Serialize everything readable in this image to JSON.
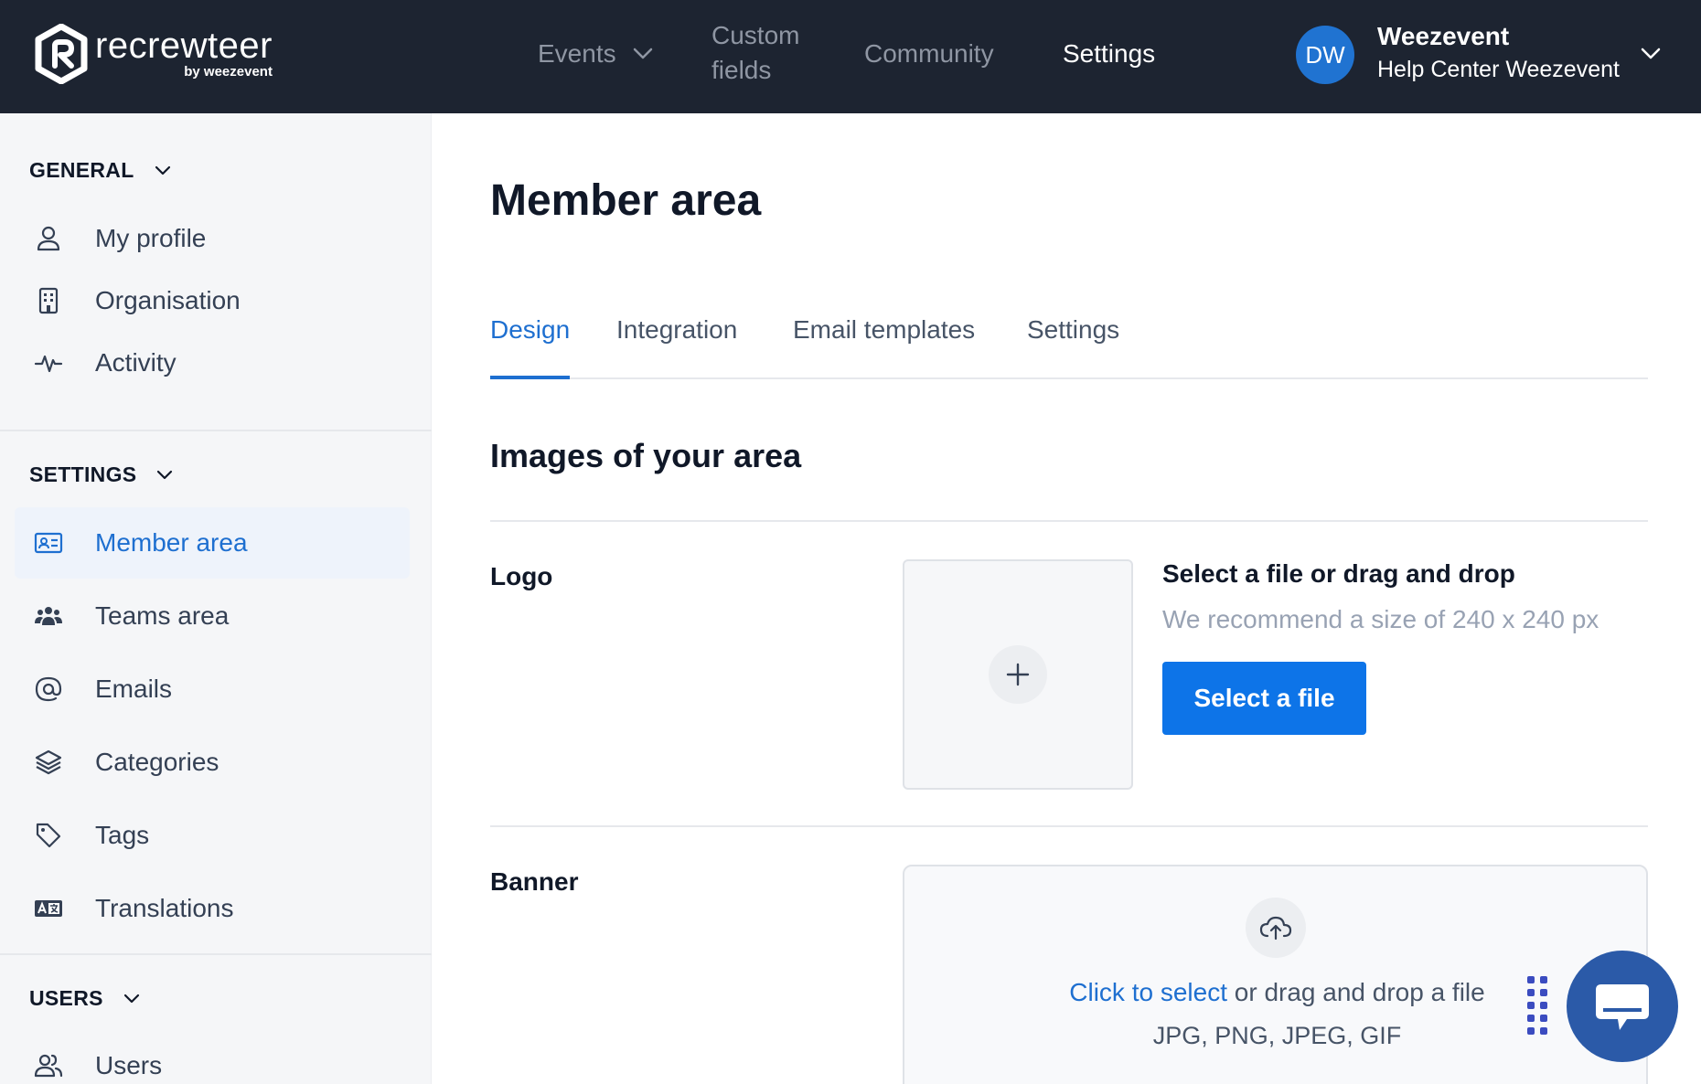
{
  "app": {
    "logo_text": "recrewteer",
    "logo_sub": "by weezevent"
  },
  "nav": {
    "events": "Events",
    "custom_fields": "Custom fields",
    "community": "Community",
    "settings": "Settings"
  },
  "user": {
    "initials": "DW",
    "name": "Weezevent",
    "subtitle": "Help Center Weezevent"
  },
  "sidebar": {
    "general": {
      "title": "GENERAL",
      "items": [
        {
          "label": "My profile",
          "icon": "user-icon"
        },
        {
          "label": "Organisation",
          "icon": "building-icon"
        },
        {
          "label": "Activity",
          "icon": "activity-icon"
        }
      ]
    },
    "settings": {
      "title": "SETTINGS",
      "items": [
        {
          "label": "Member area",
          "icon": "id-card-icon",
          "active": true
        },
        {
          "label": "Teams area",
          "icon": "team-icon"
        },
        {
          "label": "Emails",
          "icon": "at-icon"
        },
        {
          "label": "Categories",
          "icon": "layers-icon"
        },
        {
          "label": "Tags",
          "icon": "tag-icon"
        },
        {
          "label": "Translations",
          "icon": "translate-icon"
        }
      ]
    },
    "users": {
      "title": "USERS",
      "items": [
        {
          "label": "Users",
          "icon": "users-icon"
        }
      ]
    }
  },
  "main": {
    "title": "Member area",
    "tabs": [
      {
        "label": "Design",
        "active": true
      },
      {
        "label": "Integration"
      },
      {
        "label": "Email templates"
      },
      {
        "label": "Settings"
      }
    ],
    "section_title": "Images of your area",
    "logo": {
      "label": "Logo",
      "upload_title": "Select a file or drag and drop",
      "upload_hint": "We recommend a size of 240 x 240 px",
      "button": "Select a file"
    },
    "banner": {
      "label": "Banner",
      "link_text": "Click to select",
      "rest_text": " or drag and drop a file",
      "formats": "JPG, PNG, JPEG, GIF"
    }
  },
  "colors": {
    "topbar": "#1d2431",
    "accent": "#1e6fd0",
    "primary_button": "#0d74e8",
    "chat": "#2b5aa8"
  }
}
